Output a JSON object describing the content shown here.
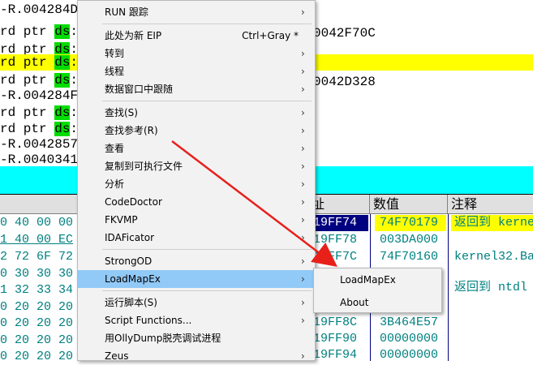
{
  "disassembly": {
    "lines": [
      {
        "prefix": "-R.004284D",
        "ds": "ds",
        "suffix": ":",
        "highlight": false
      },
      {
        "prefix": "rd ptr ",
        "ds": "ds",
        "suffix": ":",
        "highlight": false
      },
      {
        "prefix": "rd ptr ",
        "ds": "ds",
        "suffix": ":",
        "highlight": false
      },
      {
        "prefix": "rd ptr ",
        "ds": "ds",
        "suffix": ":",
        "highlight": true
      },
      {
        "prefix": "rd ptr ",
        "ds": "ds",
        "suffix": ":",
        "highlight": false
      },
      {
        "prefix": "-R.004284F",
        "ds": "",
        "suffix": "",
        "highlight": false
      },
      {
        "prefix": "rd ptr ",
        "ds": "ds",
        "suffix": ":",
        "highlight": false
      },
      {
        "prefix": "rd ptr ",
        "ds": "ds",
        "suffix": ":",
        "highlight": false
      },
      {
        "prefix": "-R.0042857",
        "ds": "",
        "suffix": "",
        "highlight": false
      },
      {
        "prefix": "-R.0040341",
        "ds": "",
        "suffix": "",
        "highlight": false
      }
    ],
    "targets": [
      {
        "row": 1,
        "text": "0042F70C"
      },
      {
        "row": 4,
        "text": "0042D328"
      }
    ]
  },
  "hexdump": {
    "lines": [
      "0 40 00 00",
      "1 40 00 EC",
      "2 72 6F 72",
      "0 30 30 30",
      "1 32 33 34",
      "0 20 20 20",
      "0 20 20 20",
      "0 20 20 20",
      "0 20 20 20"
    ]
  },
  "stack": {
    "headers": {
      "address": "址",
      "value": "数值",
      "comment": "注释"
    },
    "rows": [
      {
        "addr": "19FF74",
        "value": "74F70179",
        "comment": "返回到 kerne",
        "selected": true
      },
      {
        "addr": "19FF78",
        "value": "003DA000",
        "comment": "",
        "selected": false
      },
      {
        "addr": "19FF7C",
        "value": "74F70160",
        "comment": "kernel32.Ba",
        "selected": false
      },
      {
        "addr": "19FF80",
        "value": "",
        "comment": "",
        "selected": false
      },
      {
        "addr": "19FF84",
        "value": "",
        "comment": "返回到 ntdl",
        "selected": false
      },
      {
        "addr": "19FF88",
        "value": "",
        "comment": "",
        "selected": false
      },
      {
        "addr": "19FF8C",
        "value": "3B464E57",
        "comment": "",
        "selected": false
      },
      {
        "addr": "19FF90",
        "value": "00000000",
        "comment": "",
        "selected": false
      },
      {
        "addr": "19FF94",
        "value": "00000000",
        "comment": "",
        "selected": false
      }
    ]
  },
  "context_menu": {
    "items": [
      {
        "label": "RUN 跟踪",
        "shortcut": "",
        "submenu": true
      },
      {
        "label": "此处为新 EIP",
        "shortcut": "Ctrl+Gray *",
        "submenu": false
      },
      {
        "label": "转到",
        "shortcut": "",
        "submenu": true
      },
      {
        "label": "线程",
        "shortcut": "",
        "submenu": true
      },
      {
        "label": "数据窗口中跟随",
        "shortcut": "",
        "submenu": true
      },
      {
        "label": "查找(S)",
        "shortcut": "",
        "submenu": true
      },
      {
        "label": "查找参考(R)",
        "shortcut": "",
        "submenu": true
      },
      {
        "label": "查看",
        "shortcut": "",
        "submenu": true
      },
      {
        "label": "复制到可执行文件",
        "shortcut": "",
        "submenu": true
      },
      {
        "label": "分析",
        "shortcut": "",
        "submenu": true
      },
      {
        "label": "CodeDoctor",
        "shortcut": "",
        "submenu": true
      },
      {
        "label": "FKVMP",
        "shortcut": "",
        "submenu": true
      },
      {
        "label": "IDAFicator",
        "shortcut": "",
        "submenu": true
      },
      {
        "label": "StrongOD",
        "shortcut": "",
        "submenu": true
      },
      {
        "label": "LoadMapEx",
        "shortcut": "",
        "submenu": true,
        "active": true
      },
      {
        "label": "运行脚本(S)",
        "shortcut": "",
        "submenu": true
      },
      {
        "label": "Script Functions...",
        "shortcut": "",
        "submenu": true
      },
      {
        "label": "用OllyDump脱壳调试进程",
        "shortcut": "",
        "submenu": false
      },
      {
        "label": "Zeus",
        "shortcut": "",
        "submenu": true
      }
    ]
  },
  "submenu": {
    "items": [
      {
        "label": "LoadMapEx"
      },
      {
        "label": "About"
      }
    ]
  },
  "colors": {
    "highlight_yellow": "#ffff00",
    "ds_green": "#00dd00",
    "cyan_bar": "#00ffff",
    "selection_navy": "#000080",
    "menu_active": "#91c9f7",
    "annotation_arrow": "#e8201a"
  }
}
